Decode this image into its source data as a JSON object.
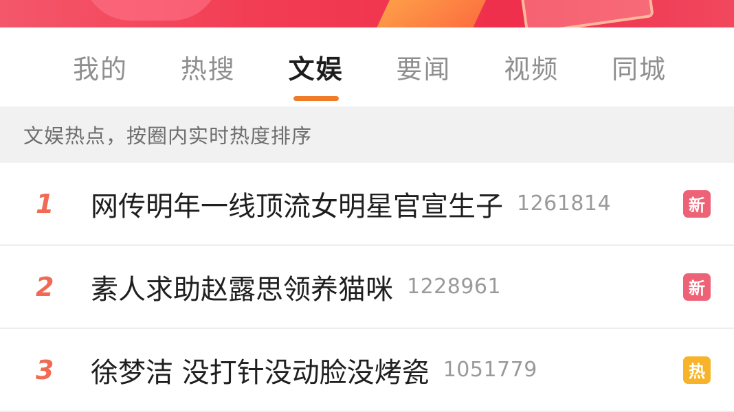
{
  "tabs": [
    {
      "label": "我的"
    },
    {
      "label": "热搜"
    },
    {
      "label": "文娱"
    },
    {
      "label": "要闻"
    },
    {
      "label": "视频"
    },
    {
      "label": "同城"
    }
  ],
  "active_tab": "文娱",
  "subtitle": "文娱热点，按圈内实时热度排序",
  "items": [
    {
      "rank": "1",
      "title": "网传明年一线顶流女明星官宣生子",
      "count": "1261814",
      "badge": "新",
      "badge_type": "new"
    },
    {
      "rank": "2",
      "title": "素人求助赵露思领养猫咪",
      "count": "1228961",
      "badge": "新",
      "badge_type": "new"
    },
    {
      "rank": "3",
      "title": "徐梦洁 没打针没动脸没烤瓷",
      "count": "1051779",
      "badge": "热",
      "badge_type": "hot"
    }
  ],
  "colors": {
    "accent": "#f07c2a",
    "rank": "#f16a53",
    "badge_new": "#ee6277",
    "badge_hot": "#f7b42b"
  }
}
